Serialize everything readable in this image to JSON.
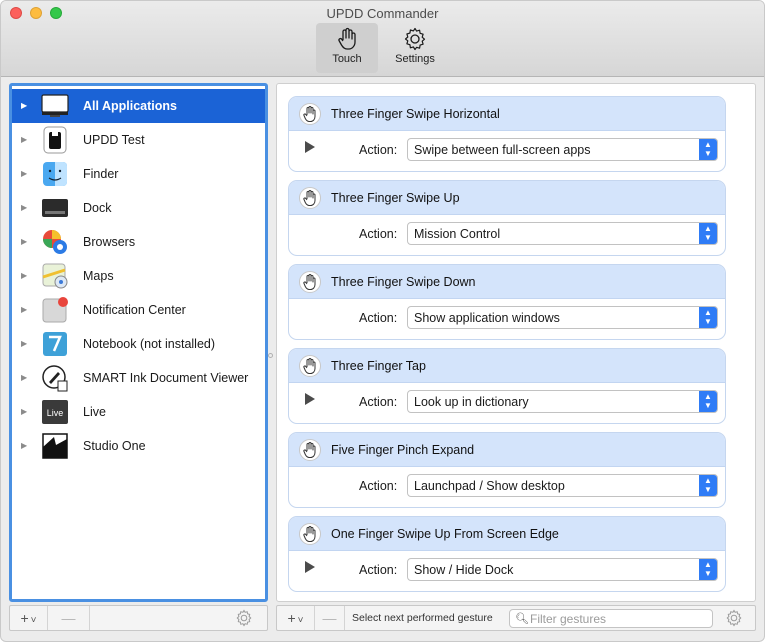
{
  "window": {
    "title": "UPDD Commander"
  },
  "toolbar": {
    "touch_label": "Touch",
    "settings_label": "Settings"
  },
  "apps": [
    {
      "label": "All Applications",
      "icon": "monitor-icon",
      "selected": true
    },
    {
      "label": "UPDD Test",
      "icon": "updd-test-icon"
    },
    {
      "label": "Finder",
      "icon": "finder-icon"
    },
    {
      "label": "Dock",
      "icon": "dock-icon"
    },
    {
      "label": "Browsers",
      "icon": "browsers-icon"
    },
    {
      "label": "Maps",
      "icon": "maps-icon"
    },
    {
      "label": "Notification Center",
      "icon": "notification-center-icon"
    },
    {
      "label": "Notebook (not installed)",
      "icon": "notebook-icon"
    },
    {
      "label": "SMART Ink Document Viewer",
      "icon": "smart-ink-icon"
    },
    {
      "label": "Live",
      "icon": "live-icon"
    },
    {
      "label": "Studio One",
      "icon": "studio-one-icon"
    }
  ],
  "left_bottom": {
    "add_label": "+",
    "chevron_label": "˅",
    "remove_label": "—"
  },
  "gestures": [
    {
      "title": "Three Finger Swipe Horizontal",
      "action_label": "Action:",
      "action": "Swipe between full-screen apps",
      "playable": true
    },
    {
      "title": "Three Finger Swipe Up",
      "action_label": "Action:",
      "action": "Mission Control",
      "playable": false
    },
    {
      "title": "Three Finger Swipe Down",
      "action_label": "Action:",
      "action": "Show application windows",
      "playable": false
    },
    {
      "title": "Three Finger Tap",
      "action_label": "Action:",
      "action": "Look up in dictionary",
      "playable": true
    },
    {
      "title": "Five Finger Pinch Expand",
      "action_label": "Action:",
      "action": "Launchpad / Show desktop",
      "playable": false
    },
    {
      "title": "One Finger Swipe Up From Screen Edge",
      "action_label": "Action:",
      "action": "Show / Hide Dock",
      "playable": true
    }
  ],
  "right_bottom": {
    "add_label": "+",
    "chevron_label": "˅",
    "remove_label": "—",
    "next_gesture_label": "Select next performed gesture",
    "filter_placeholder": "Filter gestures"
  },
  "colors": {
    "selection": "#1b63d6",
    "accent": "#2f7cf6",
    "card_header": "#d4e4fb",
    "list_border": "#4a90e2"
  }
}
